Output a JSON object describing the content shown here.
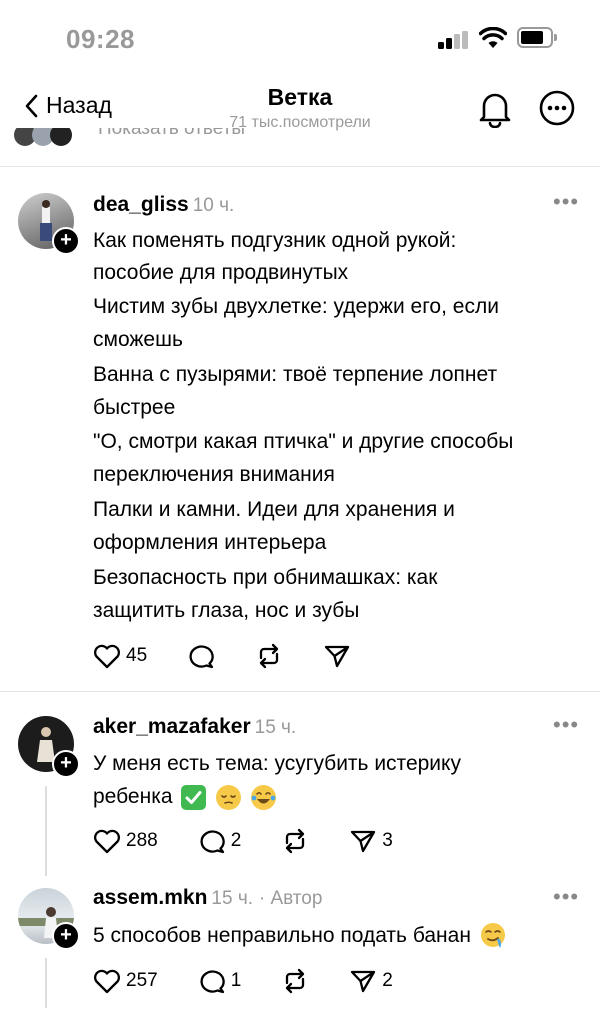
{
  "status_bar": {
    "time": "09:28"
  },
  "nav": {
    "back_label": "Назад",
    "title": "Ветка",
    "subtitle": "71 тыс.посмотрели"
  },
  "cut_row": {
    "text": "Показать ответы"
  },
  "posts": [
    {
      "username": "dea_gliss",
      "time": "10 ч.",
      "lines": [
        "Как поменять подгузник одной рукой:",
        "пособие для продвинутых",
        "Чистим зубы двухлетке: удержи его,  если",
        "сможешь",
        "Ванна с пузырями: твоё терпение лопнет",
        "быстрее",
        "\"О, смотри какая птичка\" и другие способы",
        "переключения внимания",
        "Палки и камни. Идеи для хранения и",
        "оформления интерьера",
        "Безопасность при обнимашках: как",
        "защитить глаза, нос и зубы"
      ],
      "likes": "45"
    },
    {
      "username": "aker_mazafaker",
      "time": "15 ч.",
      "lines": [
        "У меня есть тема: усугубить истерику",
        "ребенка"
      ],
      "emojis": [
        "check-mark-emoji",
        "pensive-face-emoji",
        "laughing-tears-emoji"
      ],
      "likes": "288",
      "comments": "2",
      "shares": "3"
    },
    {
      "username": "assem.mkn",
      "time": "15 ч.",
      "author_tag": "· Автор",
      "lines": [
        "5 способов неправильно подать банан"
      ],
      "emojis": [
        "drooling-face-emoji"
      ],
      "likes": "257",
      "comments": "1",
      "shares": "2"
    }
  ],
  "colors": {
    "muted": "#999999",
    "divider": "#e3e3e3",
    "check_green": "#3fb950",
    "emoji_yellow": "#f7c948"
  }
}
